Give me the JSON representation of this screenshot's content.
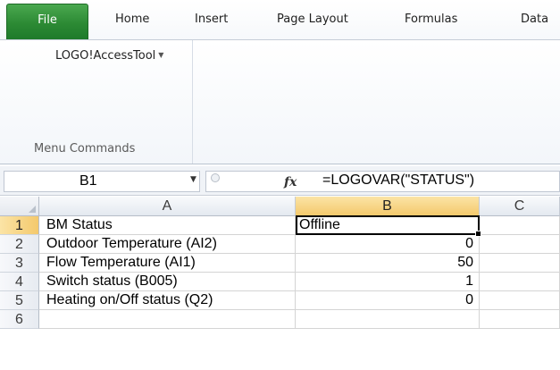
{
  "ribbon": {
    "tabs": [
      "File",
      "Home",
      "Insert",
      "Page Layout",
      "Formulas",
      "Data"
    ],
    "addin_button": "LOGO!AccessTool",
    "addin_arrow_icon": "dropdown-arrow-icon",
    "group_label": "Menu Commands"
  },
  "formula_bar": {
    "name_box": "B1",
    "fx_label": "fx",
    "formula": "=LOGOVAR(\"STATUS\")"
  },
  "sheet": {
    "columns": [
      "A",
      "B",
      "C"
    ],
    "rows": [
      {
        "num": "1",
        "a": "BM Status",
        "b": "Offline"
      },
      {
        "num": "2",
        "a": "Outdoor Temperature (AI2)",
        "b": "0"
      },
      {
        "num": "3",
        "a": "Flow Temperature (AI1)",
        "b": "50"
      },
      {
        "num": "4",
        "a": "Switch status (B005)",
        "b": "1"
      },
      {
        "num": "5",
        "a": "Heating on/Off status (Q2)",
        "b": "0"
      },
      {
        "num": "6",
        "a": "",
        "b": ""
      }
    ],
    "selected_cell": "B1"
  }
}
